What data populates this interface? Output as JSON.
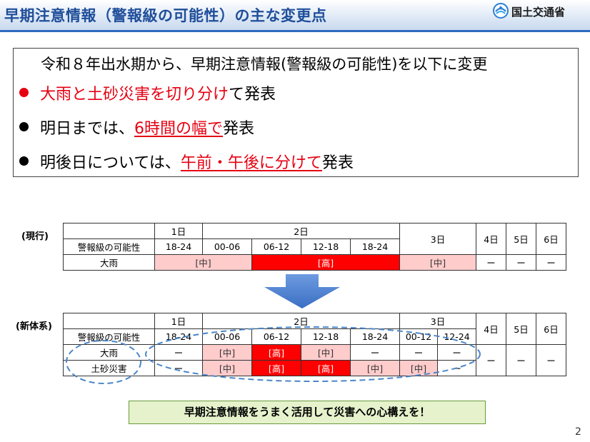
{
  "header": {
    "title": "早期注意情報（警報級の可能性）の主な変更点",
    "org_name": "国土交通省",
    "logo_icon": "mlit-logo-icon"
  },
  "summary": {
    "lead": "令和８年出水期から、早期注意情報(警報級の可能性)を以下に変更",
    "bullets": [
      {
        "color": "#e60012",
        "parts": [
          "大雨と土砂災害を切り分け",
          "て発表"
        ]
      },
      {
        "color": "#000000",
        "parts": [
          "明日までは、",
          "6時間の幅で",
          "発表"
        ]
      },
      {
        "color": "#000000",
        "parts": [
          "明後日については、",
          "午前・午後に分けて",
          "発表"
        ]
      }
    ]
  },
  "current_table": {
    "label": "(現行)",
    "row_header": "警報級の可能性",
    "day1": "1日",
    "day2": "2日",
    "day3": "3日",
    "day4": "4日",
    "day5": "5日",
    "day6": "6日",
    "times": [
      "18-24",
      "00-06",
      "06-12",
      "12-18",
      "18-24"
    ],
    "rain_label": "大雨",
    "rain_mid1": "[中]",
    "rain_high": "[高]",
    "rain_mid2": "[中]",
    "dash": "ー"
  },
  "new_table": {
    "label": "(新体系)",
    "row_header": "警報級の可能性",
    "day1": "1日",
    "day2": "2日",
    "day3": "3日",
    "day4": "4日",
    "day5": "5日",
    "day6": "6日",
    "times": [
      "18-24",
      "00-06",
      "06-12",
      "12-18",
      "18-24",
      "00-12",
      "12-24"
    ],
    "rain_label": "大雨",
    "rain_cells": [
      "ー",
      "[中]",
      "[高]",
      "[中]",
      "ー",
      "ー",
      "ー"
    ],
    "landslide_label": "土砂災害",
    "landslide_cells": [
      "ー",
      "[中]",
      "[高]",
      "[高]",
      "[中]",
      "[中]",
      "ー"
    ],
    "dash": "ー"
  },
  "banner": "早期注意情報をうまく活用して災害への心構えを！",
  "page_number": "2",
  "colors": {
    "title_blue": "#1f4e9a",
    "accent_red": "#e60012",
    "cell_red": "#ff0000",
    "cell_pink": "#ffcccc",
    "banner_green": "#e5f2cc",
    "arrow_blue": "#4a7fd0"
  }
}
